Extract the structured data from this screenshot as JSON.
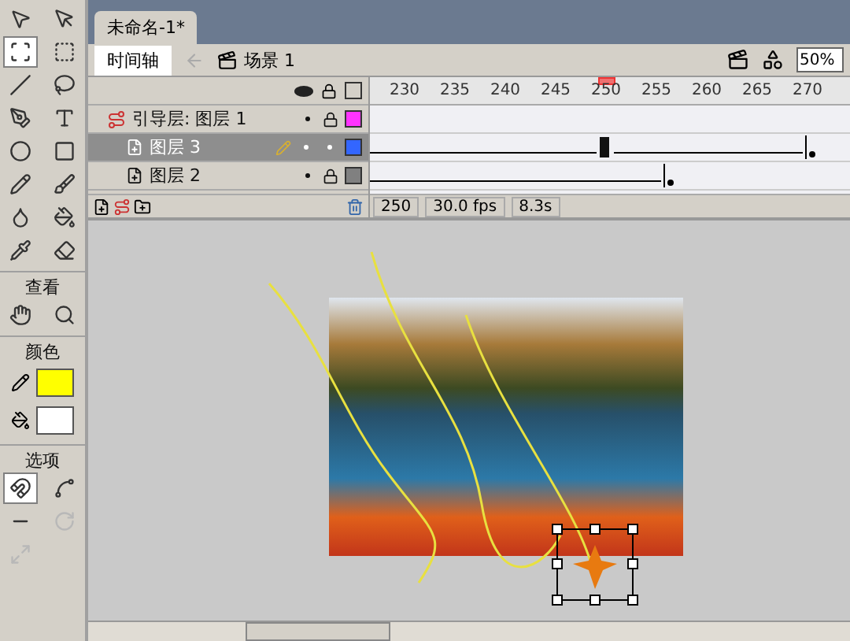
{
  "toolbox": {
    "tools": [
      {
        "kind": "arrow",
        "selected": false
      },
      {
        "kind": "subselect",
        "selected": false
      },
      {
        "kind": "transform",
        "selected": true
      },
      {
        "kind": "fill-transform",
        "selected": false
      },
      {
        "kind": "line",
        "selected": false
      },
      {
        "kind": "lasso",
        "selected": false
      },
      {
        "kind": "pen",
        "selected": false
      },
      {
        "kind": "text",
        "selected": false
      },
      {
        "kind": "oval",
        "selected": false
      },
      {
        "kind": "rect",
        "selected": false
      },
      {
        "kind": "pencil",
        "selected": false
      },
      {
        "kind": "brush",
        "selected": false
      },
      {
        "kind": "ink",
        "selected": false
      },
      {
        "kind": "bucket",
        "selected": false
      },
      {
        "kind": "dropper",
        "selected": false
      },
      {
        "kind": "eraser",
        "selected": false
      }
    ],
    "view_label": "查看",
    "view_tools": [
      {
        "kind": "hand",
        "selected": false
      },
      {
        "kind": "zoom",
        "selected": false
      }
    ],
    "colors_label": "颜色",
    "stroke": {
      "color": "#ffff00"
    },
    "fill": {
      "color": "#ffffff"
    },
    "options_label": "选项",
    "options": [
      {
        "kind": "magnet",
        "selected": true,
        "disabled": false
      },
      {
        "kind": "smooth",
        "selected": false,
        "disabled": false
      },
      {
        "kind": "straighten",
        "selected": false,
        "disabled": false
      },
      {
        "kind": "rotate",
        "selected": false,
        "disabled": true
      },
      {
        "kind": "scale",
        "selected": false,
        "disabled": true
      }
    ]
  },
  "document_tab": {
    "title": "未命名-1*"
  },
  "edit_bar": {
    "timeline_button": "时间轴",
    "scene": "场景 1",
    "zoom": "50%"
  },
  "timeline": {
    "ruler": [
      {
        "label": "230",
        "current": false
      },
      {
        "label": "235",
        "current": false
      },
      {
        "label": "240",
        "current": false
      },
      {
        "label": "245",
        "current": false
      },
      {
        "label": "250",
        "current": true
      },
      {
        "label": "255",
        "current": false
      },
      {
        "label": "260",
        "current": false
      },
      {
        "label": "265",
        "current": false
      },
      {
        "label": "270",
        "current": false
      }
    ],
    "layers": [
      {
        "name": "引导层: 图层 1",
        "kind": "guide",
        "selected": false,
        "locked": true,
        "color": "#ff33ff"
      },
      {
        "name": "图层 3",
        "kind": "guided",
        "selected": true,
        "locked": false,
        "color": "#3366ff"
      },
      {
        "name": "图层 2",
        "kind": "guided",
        "selected": false,
        "locked": true,
        "color": "#808080"
      }
    ],
    "status": {
      "frame": "250",
      "fps": "30.0 fps",
      "time": "8.3s"
    }
  }
}
